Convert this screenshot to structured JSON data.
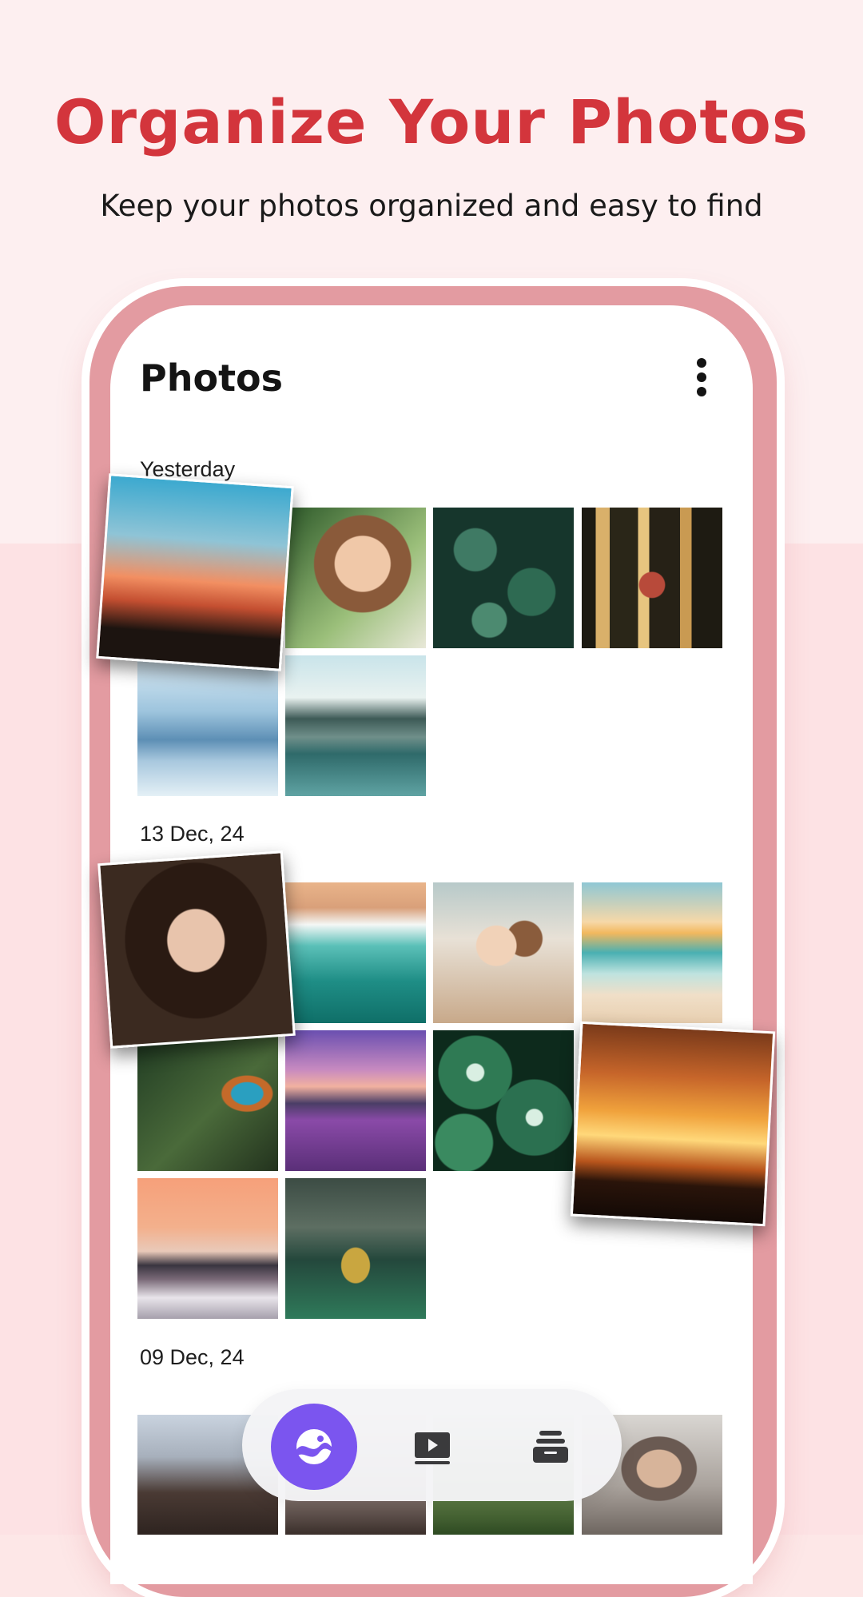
{
  "header": {
    "headline": "Organize Your Photos",
    "subline": "Keep your photos organized and easy to find"
  },
  "app": {
    "title": "Photos",
    "menu_icon": "more-vertical-icon"
  },
  "sections": [
    {
      "label": "Yesterday",
      "photos": [
        "sunset-silhouette",
        "woman-portrait",
        "green-leaves",
        "forest-bridge",
        "foggy-mountains",
        "mountain-lake"
      ]
    },
    {
      "label": "13 Dec, 24",
      "photos": [
        "woman-closeup",
        "ocean-waves",
        "mother-child-beach",
        "beach-sunset",
        "kingfisher",
        "lavender-field",
        "calathea-plant",
        "family-sunset",
        "mountain-peak",
        "lake-island"
      ]
    },
    {
      "label": "09 Dec, 24",
      "photos": [
        "crowd-cheering",
        "people-street",
        "green-field",
        "father-child"
      ]
    }
  ],
  "bottom_nav": {
    "items": [
      {
        "name": "photos",
        "icon": "photos-icon",
        "active": true
      },
      {
        "name": "videos",
        "icon": "video-icon",
        "active": false
      },
      {
        "name": "albums",
        "icon": "albums-icon",
        "active": false
      }
    ]
  },
  "colors": {
    "accent": "#d3353c",
    "nav_active": "#7b55ef",
    "phone_frame": "#e39ba1"
  }
}
